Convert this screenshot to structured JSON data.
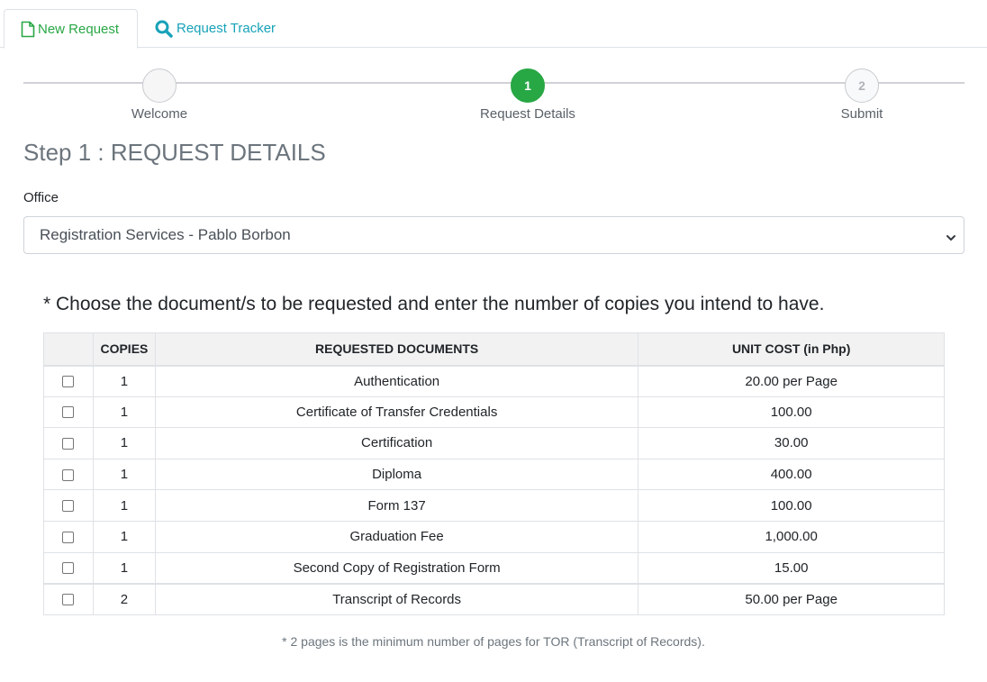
{
  "tabs": [
    {
      "label": "New Request",
      "icon": "file-icon",
      "active": true,
      "color": "#28a745"
    },
    {
      "label": "Request Tracker",
      "icon": "search-icon",
      "active": false,
      "color": "#17a2b8"
    }
  ],
  "stepper": {
    "steps": [
      {
        "label": "Welcome",
        "number": ""
      },
      {
        "label": "Request Details",
        "number": "1",
        "state": "active"
      },
      {
        "label": "Submit",
        "number": "2",
        "state": "pending"
      }
    ],
    "active_color": "#28a745"
  },
  "heading": "Step 1 : REQUEST DETAILS",
  "office": {
    "label": "Office",
    "selected": "Registration Services - Pablo Borbon"
  },
  "instruction": "* Choose the document/s to be requested and enter the number of copies you intend to have.",
  "table": {
    "headers": [
      "",
      "COPIES",
      "REQUESTED DOCUMENTS",
      "UNIT COST (in Php)"
    ],
    "rows": [
      {
        "copies": "1",
        "document": "Authentication",
        "cost": "20.00 per Page",
        "checked": false
      },
      {
        "copies": "1",
        "document": "Certificate of Transfer Credentials",
        "cost": "100.00",
        "checked": false
      },
      {
        "copies": "1",
        "document": "Certification",
        "cost": "30.00",
        "checked": false
      },
      {
        "copies": "1",
        "document": "Diploma",
        "cost": "400.00",
        "checked": false
      },
      {
        "copies": "1",
        "document": "Form 137",
        "cost": "100.00",
        "checked": false
      },
      {
        "copies": "1",
        "document": "Graduation Fee",
        "cost": "1,000.00",
        "checked": false
      },
      {
        "copies": "1",
        "document": "Second Copy of Registration Form",
        "cost": "15.00",
        "checked": false
      },
      {
        "copies": "2",
        "document": "Transcript of Records",
        "cost": "50.00 per Page",
        "checked": false
      }
    ]
  },
  "footnote": "* 2 pages is the minimum number of pages for TOR (Transcript of Records)."
}
